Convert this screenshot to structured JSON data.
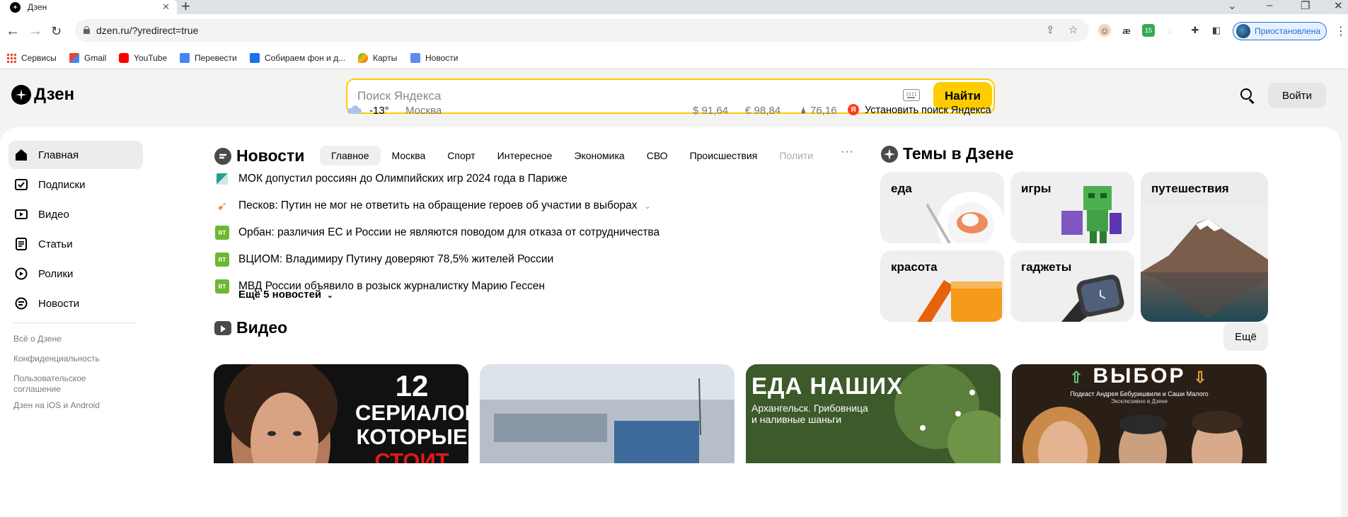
{
  "browser": {
    "tab_title": "Дзен",
    "new_tab": "+",
    "url": "dzen.ru/?yredirect=true",
    "profile_status": "Приостановлена",
    "ext_badge": "15",
    "bookmarks": [
      "Сервисы",
      "Gmail",
      "YouTube",
      "Перевести",
      "Собираем фон и д...",
      "Карты",
      "Новости"
    ]
  },
  "header": {
    "logo": "Дзен",
    "search_placeholder": "Поиск Яндекса",
    "search_button": "Найти",
    "login": "Войти"
  },
  "info_bar": {
    "temperature": "-13°",
    "city": "Москва",
    "usd": "$ 91,64",
    "eur": "€ 98,84",
    "oil": "76,16",
    "install_search": "Установить поиск Яндекса"
  },
  "sidebar": {
    "items": [
      {
        "label": "Главная",
        "icon": "home-icon"
      },
      {
        "label": "Подписки",
        "icon": "subscriptions-icon"
      },
      {
        "label": "Видео",
        "icon": "video-icon"
      },
      {
        "label": "Статьи",
        "icon": "articles-icon"
      },
      {
        "label": "Ролики",
        "icon": "clips-icon"
      },
      {
        "label": "Новости",
        "icon": "news-icon"
      }
    ],
    "links": [
      "Всё о Дзене",
      "Конфиденциальность",
      "Пользовательское соглашение",
      "Дзен на iOS и Android"
    ]
  },
  "news": {
    "title": "Новости",
    "tabs": [
      "Главное",
      "Москва",
      "Спорт",
      "Интересное",
      "Экономика",
      "СВО",
      "Происшествия",
      "Полити"
    ],
    "items": [
      {
        "text": "МОК допустил россиян до Олимпийских игр 2024 года в Париже",
        "source_icon": "triangle-source-icon"
      },
      {
        "text": "Песков: Путин не мог не ответить на обращение героев об участии в выборах",
        "source_icon": "bird-source-icon"
      },
      {
        "text": "Орбан: различия ЕС и России не являются поводом для отказа от сотрудничества",
        "source_icon": "rt-source-icon"
      },
      {
        "text": "ВЦИОМ: Владимиру Путину доверяют 78,5% жителей России",
        "source_icon": "rt-source-icon"
      },
      {
        "text": "МВД России объявило в розыск журналистку Марию Гессен",
        "source_icon": "rt-source-icon"
      }
    ],
    "rt_label": "RT",
    "more": "Ещё 5 новостей"
  },
  "topics": {
    "title": "Темы в Дзене",
    "items": [
      "еда",
      "игры",
      "путешествия",
      "красота",
      "гаджеты"
    ]
  },
  "video": {
    "title": "Видео",
    "more": "Ещё",
    "cards": [
      {
        "line1": "12",
        "line2": "СЕРИАЛОВ",
        "line3": "КОТОРЫЕ",
        "line4": "СТОИТ"
      },
      {
        "line1": ""
      },
      {
        "line1": "ЕДА НАШИХ",
        "line2": "Архангельск. Грибовница",
        "line3": "и наливные шаньги"
      },
      {
        "line1": "ВЫБОР",
        "line2": "Подкаст Андрея Бебуришвили и Саши Малого",
        "line3": "Эксклюзивно в Дзене"
      }
    ]
  },
  "colors": {
    "accent": "#ffcc00",
    "page_bg": "#f3f3f2",
    "rt_green": "#6cb833"
  }
}
